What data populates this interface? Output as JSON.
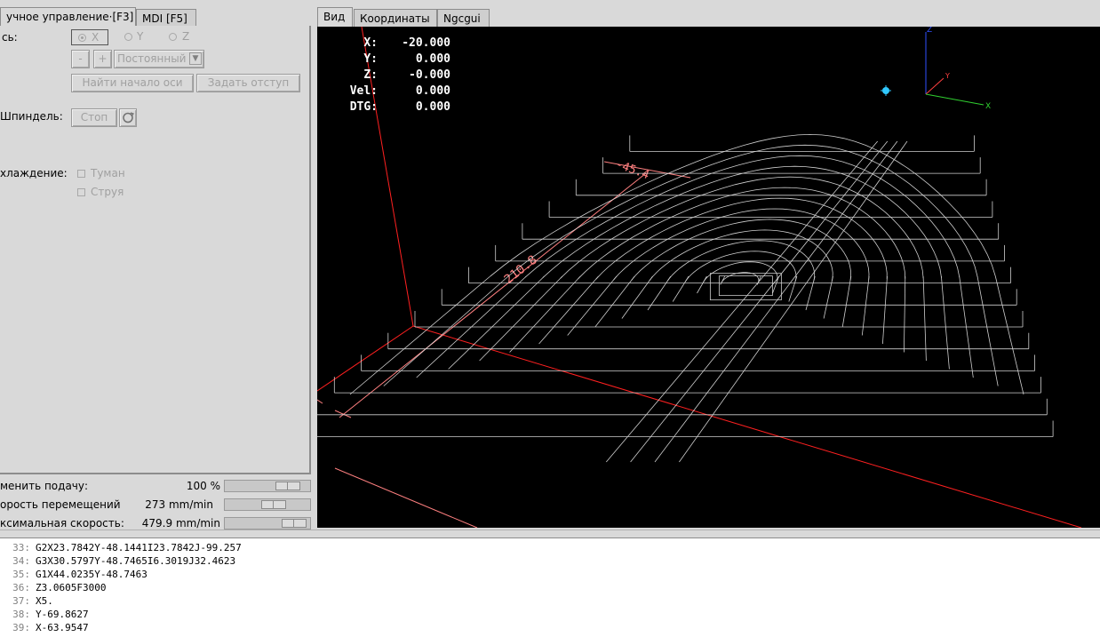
{
  "left_tabs": [
    "учное управление·[F3]",
    "MDI [F5]"
  ],
  "view_tabs": [
    "Вид",
    "Координаты",
    "Ngcgui"
  ],
  "manual": {
    "axis_label": "сь:",
    "axes": [
      "X",
      "Y",
      "Z"
    ],
    "minus": "-",
    "plus": "+",
    "jog_mode": "Постоянный",
    "home_button": "Найти начало оси",
    "touchoff_button": "Задать отступ",
    "spindle_label": "Шпиндель:",
    "spindle_stop": "Стоп",
    "coolant_label": "хлаждение:",
    "mist": "Туман",
    "flood": "Струя"
  },
  "overrides": {
    "feed_label": "менить подачу:",
    "feed_value": "100 %",
    "feed_level": 0.85,
    "rapid_label": "орость перемещений",
    "rapid_value": "273 mm/min",
    "rapid_level": 0.6,
    "maxvel_label": "ксимальная скорость:",
    "maxvel_value": "479.9 mm/min",
    "maxvel_level": 0.95
  },
  "dro": {
    "rows": [
      {
        "label": "X:",
        "value": "-20.000"
      },
      {
        "label": "Y:",
        "value": "0.000"
      },
      {
        "label": "Z:",
        "value": "-0.000"
      },
      {
        "label": "Vel:",
        "value": "0.000"
      },
      {
        "label": "DTG:",
        "value": "0.000"
      }
    ]
  },
  "view_labels": {
    "dim_x": "-45.4",
    "dim_y": "210.8",
    "axis_z": "Z",
    "axis_y": "Y",
    "axis_x": "X"
  },
  "colors": {
    "view_bg": "#000000",
    "toolpath": "#e6e6e6",
    "limits": "#ff2020",
    "dims": "#ff8080"
  },
  "gcode": [
    {
      "n": "33:",
      "code": "G2X23.7842Y-48.1441I23.7842J-99.257"
    },
    {
      "n": "34:",
      "code": "G3X30.5797Y-48.7465I6.3019J32.4623"
    },
    {
      "n": "35:",
      "code": "G1X44.0235Y-48.7463"
    },
    {
      "n": "36:",
      "code": "Z3.0605F3000"
    },
    {
      "n": "37:",
      "code": "X5."
    },
    {
      "n": "38:",
      "code": "Y-69.8627"
    },
    {
      "n": "39:",
      "code": "X-63.9547"
    }
  ]
}
